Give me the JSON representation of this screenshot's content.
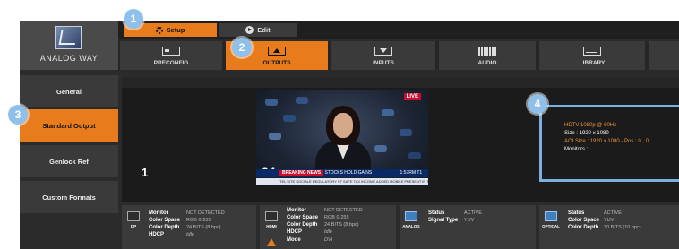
{
  "brand": {
    "name": "ANALOG WAY"
  },
  "modes": {
    "setup": "Setup",
    "edit": "Edit"
  },
  "tabs": [
    {
      "label": "PRECONFIG",
      "icon": "preconfig-icon"
    },
    {
      "label": "OUTPUTS",
      "icon": "outputs-icon",
      "active": true
    },
    {
      "label": "INPUTS",
      "icon": "inputs-icon"
    },
    {
      "label": "AUDIO",
      "icon": "audio-icon"
    },
    {
      "label": "LIBRARY",
      "icon": "library-icon"
    }
  ],
  "sidebar": {
    "items": [
      {
        "label": "General"
      },
      {
        "label": "Standard Output",
        "active": true
      },
      {
        "label": "Genlock Ref"
      },
      {
        "label": "Custom Formats"
      }
    ]
  },
  "preview": {
    "output_number": "1",
    "live_tag": "LIVE",
    "channel_number": "24",
    "ticker_red": "BREAKING NEWS",
    "ticker_text": "STOCKS HOLD GAINS",
    "ticker_code": "1:57RM T1",
    "ticker_sub": "TEL SITE SOCIALE REGULATORY ST SAFE TAX INCOME ADDED MOBILE PRESENT IN TAXATION"
  },
  "output_info": {
    "format": "HDTV 1080p @ 60Hz",
    "size": "Size : 1920 x 1080",
    "aoi": "AOI Size : 1920 x 1080 - Pos : 0 , 0",
    "monitors": "Monitors :"
  },
  "cards": [
    {
      "connector": "DP",
      "rows": [
        {
          "key": "Monitor",
          "value": "NOT DETECTED"
        },
        {
          "key": "Color Space",
          "value": "RGB 0-255"
        },
        {
          "key": "Color Depth",
          "value": "24 BITS (8 bpc)"
        },
        {
          "key": "HDCP",
          "value": "Idle"
        }
      ]
    },
    {
      "connector": "HDMI",
      "rows": [
        {
          "key": "Monitor",
          "value": "NOT DETECTED"
        },
        {
          "key": "Color Space",
          "value": "RGB 0-255"
        },
        {
          "key": "Color Depth",
          "value": "24 BITS (8 bpc)"
        },
        {
          "key": "HDCP",
          "value": "Idle"
        },
        {
          "key": "Mode",
          "value": "DVI"
        }
      ]
    },
    {
      "connector": "ANALOG",
      "rows": [
        {
          "key": "Status",
          "value": "ACTIVE"
        },
        {
          "key": "Signal Type",
          "value": "YUV"
        }
      ]
    },
    {
      "connector": "OPTICAL",
      "rows": [
        {
          "key": "Status",
          "value": "ACTIVE"
        },
        {
          "key": "Color Space",
          "value": "YUV"
        },
        {
          "key": "Color Depth",
          "value": "30 BITS (10 bpc)"
        }
      ]
    }
  ],
  "callouts": [
    "1",
    "2",
    "3",
    "4"
  ],
  "colors": {
    "accent": "#e87b1c",
    "panel": "#2b2b2b",
    "callout": "#8fc0ea",
    "info_orange": "#e8943a"
  }
}
